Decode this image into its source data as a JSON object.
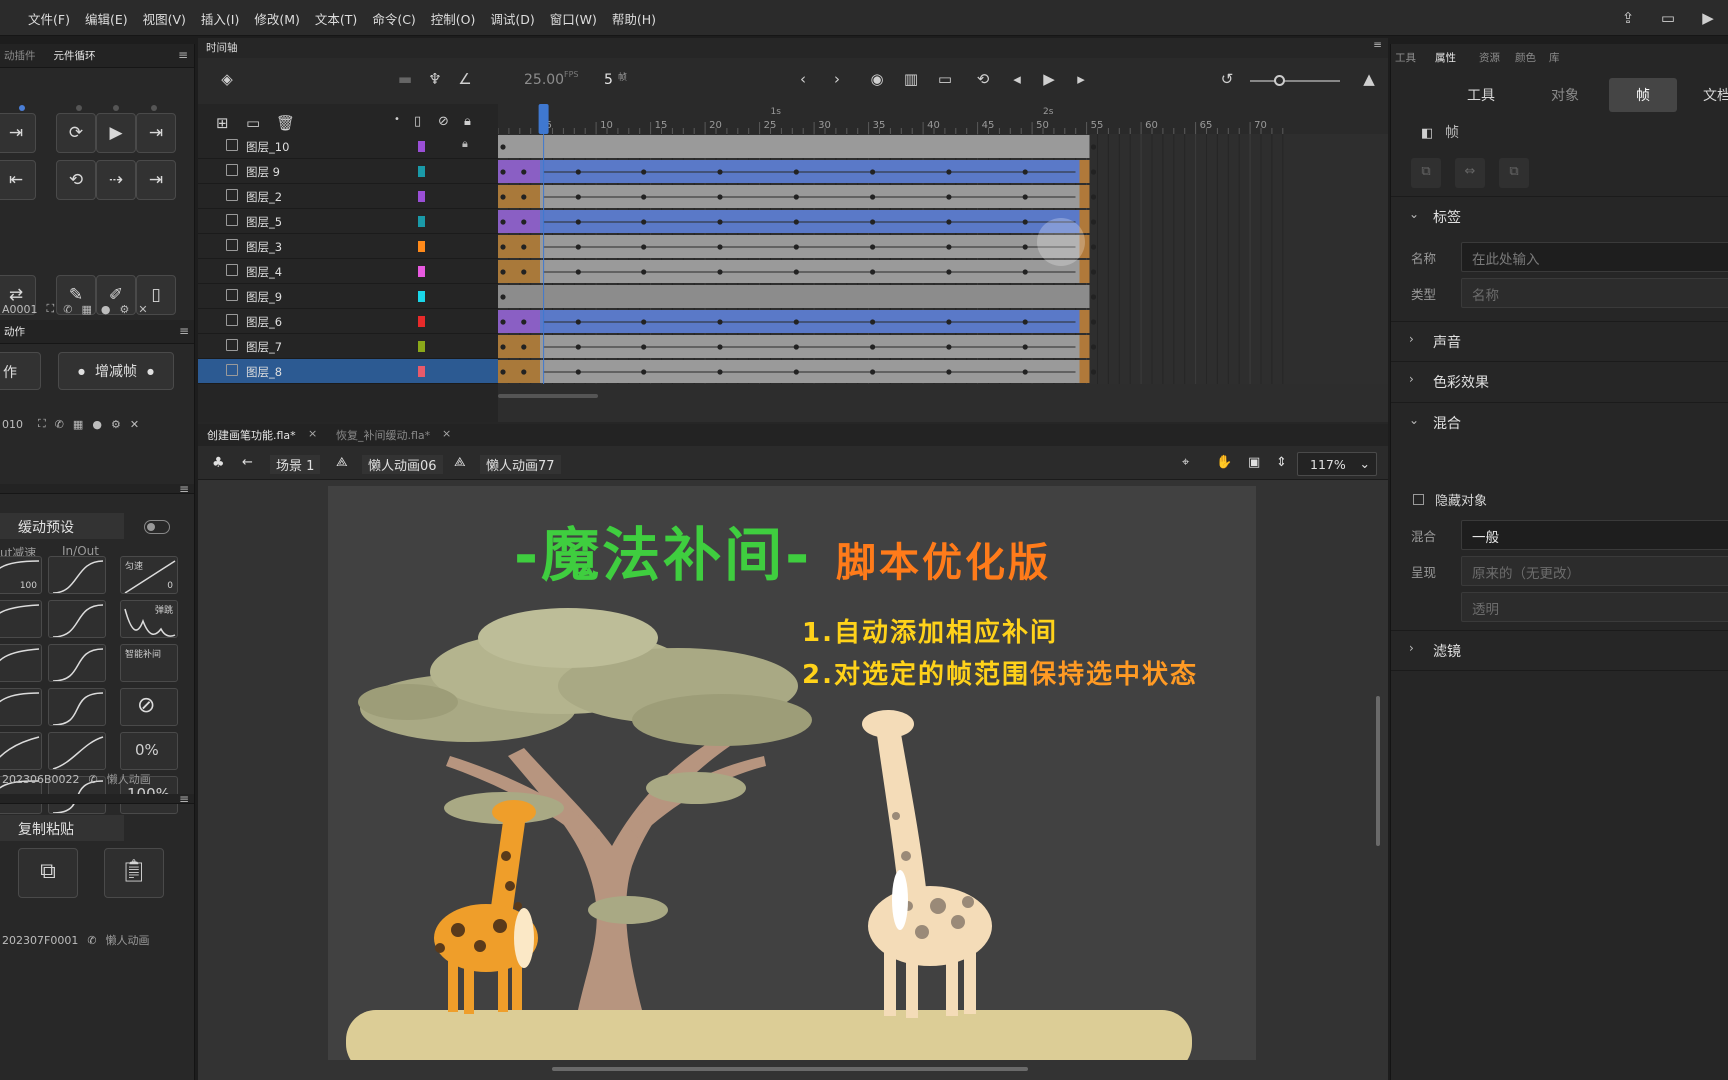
{
  "menu": [
    "文件(F)",
    "编辑(E)",
    "视图(V)",
    "插入(I)",
    "修改(M)",
    "文本(T)",
    "命令(C)",
    "控制(O)",
    "调试(D)",
    "窗口(W)",
    "帮助(H)"
  ],
  "left": {
    "tab1": "动插件",
    "tab2": "元件循环",
    "id1": "A0001",
    "section2_title": "动作",
    "btn_action": "作",
    "btn_addremove": "增减帧",
    "id2": "010",
    "ease_title": "缓动预设",
    "ease_col1": "ut减速",
    "ease_col2": "In/Out",
    "ease_labels": {
      "v100": "100",
      "uniform": "匀速",
      "zero": "0",
      "bounce": "弹跳",
      "smart": "智能补间",
      "pct0": "0%",
      "pct100": "100%"
    },
    "id3": "202306B0022",
    "brand": "懒人动画",
    "copy_title": "复制粘贴",
    "id4": "202307F0001"
  },
  "timeline": {
    "title": "时间轴",
    "fps_value": "25.00",
    "fps_unit": "FPS",
    "frame_value": "5",
    "frame_unit": "帧",
    "ruler_ticks": [
      "5",
      "10",
      "15",
      "20",
      "25",
      "30",
      "35",
      "40",
      "45",
      "50",
      "55",
      "60",
      "65",
      "70"
    ],
    "ruler_seconds": [
      "1s",
      "2s"
    ],
    "layers": [
      {
        "name": "图层_10",
        "color": "#9a4fd6",
        "locked": true
      },
      {
        "name": "图层 9",
        "color": "#1a9aa8",
        "locked": false
      },
      {
        "name": "图层_2",
        "color": "#9a4fd6",
        "locked": false
      },
      {
        "name": "图层_5",
        "color": "#1a9aa8",
        "locked": false
      },
      {
        "name": "图层_3",
        "color": "#ff8a1a",
        "locked": false
      },
      {
        "name": "图层_4",
        "color": "#e85ae0",
        "locked": false
      },
      {
        "name": "图层_9",
        "color": "#1ad6e8",
        "locked": false
      },
      {
        "name": "图层_6",
        "color": "#e82a2a",
        "locked": false
      },
      {
        "name": "图层_7",
        "color": "#8aa81a",
        "locked": false
      },
      {
        "name": "图层_8",
        "color": "#e85a6a",
        "locked": false,
        "selected": true
      }
    ]
  },
  "doc_tabs": [
    "创建画笔功能.fla*",
    "恢复_补间缓动.fla*"
  ],
  "editbar": {
    "scene": "场景 1",
    "symbol1": "懒人动画06",
    "symbol2": "懒人动画77",
    "zoom": "117%"
  },
  "stage": {
    "title_main": "-魔法补间-",
    "title_sub": "脚本优化版",
    "line1": "1.自动添加相应补间",
    "line2_a": "2.对选定的帧范围",
    "line2_b": "保持选中状态",
    "colors": {
      "green": "#3fce3f",
      "orange": "#ff7b1a",
      "yellow": "#ffd21a"
    }
  },
  "right": {
    "tabs": [
      "工具",
      "属性",
      "资源",
      "颜色",
      "库"
    ],
    "segments": [
      "工具",
      "对象",
      "帧",
      "文档"
    ],
    "frame_header": "帧",
    "section_label": "标签",
    "name_label": "名称",
    "name_placeholder": "在此处输入",
    "type_label": "类型",
    "type_value": "名称",
    "section_sound": "声音",
    "section_color": "色彩效果",
    "section_blend": "混合",
    "hide_object": "隐藏对象",
    "blend_label": "混合",
    "blend_value": "一般",
    "render_label": "呈现",
    "render_value": "原来的（无更改）",
    "alpha_value": "透明",
    "section_filter": "滤镜"
  }
}
